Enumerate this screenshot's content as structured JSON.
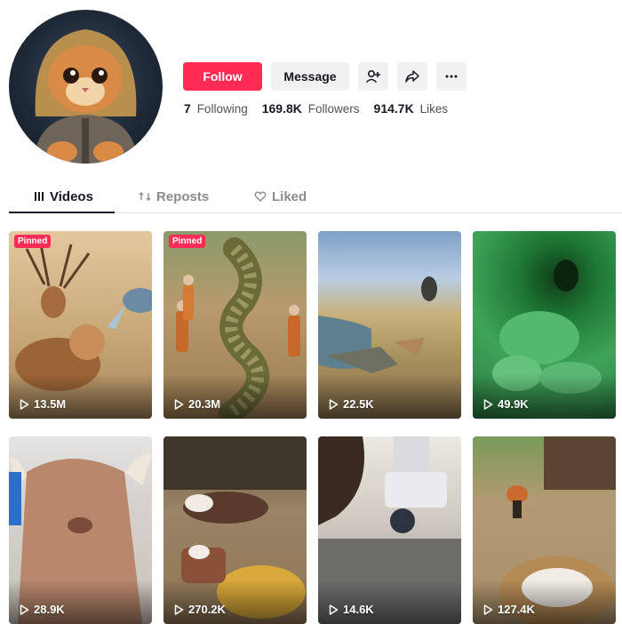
{
  "profile": {
    "follow_label": "Follow",
    "message_label": "Message",
    "stats": {
      "following_count": "7",
      "following_label": "Following",
      "followers_count": "169.8K",
      "followers_label": "Followers",
      "likes_count": "914.7K",
      "likes_label": "Likes"
    }
  },
  "tabs": [
    {
      "label": "Videos",
      "icon": "grid-icon",
      "active": true
    },
    {
      "label": "Reposts",
      "icon": "repost-icon",
      "active": false
    },
    {
      "label": "Liked",
      "icon": "heart-icon",
      "active": false
    }
  ],
  "colors": {
    "accent": "#fe2c55",
    "text": "#161823",
    "muted": "#8a8b91"
  },
  "videos": [
    {
      "views": "13.5M",
      "pinned": "Pinned"
    },
    {
      "views": "20.3M",
      "pinned": "Pinned"
    },
    {
      "views": "22.5K",
      "pinned": ""
    },
    {
      "views": "49.9K",
      "pinned": ""
    },
    {
      "views": "28.9K",
      "pinned": ""
    },
    {
      "views": "270.2K",
      "pinned": ""
    },
    {
      "views": "14.6K",
      "pinned": ""
    },
    {
      "views": "127.4K",
      "pinned": ""
    }
  ]
}
